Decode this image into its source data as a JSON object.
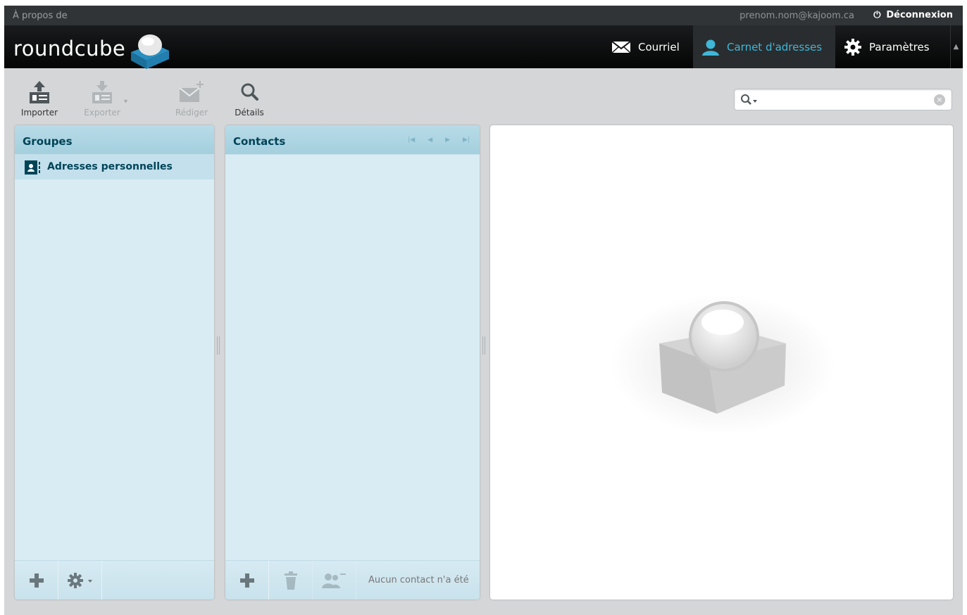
{
  "topline": {
    "about": "À propos de",
    "username": "prenom.nom@kajoom.ca",
    "logout": "Déconnexion"
  },
  "header": {
    "logo_text": "roundcube",
    "tasks": [
      {
        "label": "Courriel",
        "icon": "mail-icon"
      },
      {
        "label": "Carnet d'adresses",
        "icon": "person-icon",
        "active": true
      },
      {
        "label": "Paramètres",
        "icon": "gear-icon"
      }
    ]
  },
  "toolbar": {
    "import": "Importer",
    "export": "Exporter",
    "compose": "Rédiger",
    "details": "Détails"
  },
  "search": {
    "value": "",
    "placeholder": ""
  },
  "groups": {
    "title": "Groupes",
    "items": [
      {
        "label": "Adresses personnelles",
        "selected": true
      }
    ]
  },
  "contacts": {
    "title": "Contacts",
    "count_text": "Aucun contact n'a été"
  },
  "colors": {
    "accent": "#3eb7d9",
    "panel_bg": "#d9ecf4",
    "panel_header": "#a4cfde",
    "header_bg": "#050505"
  }
}
